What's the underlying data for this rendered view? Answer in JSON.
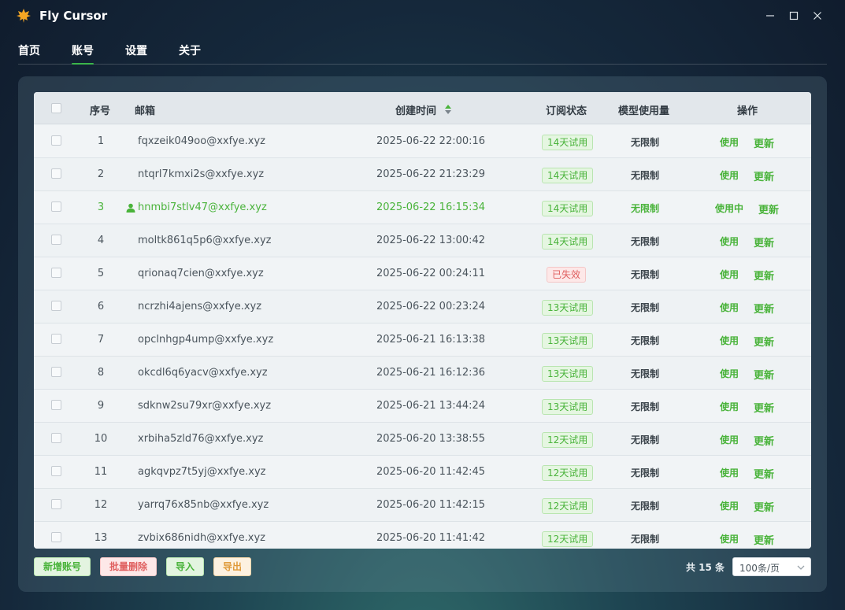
{
  "app": {
    "title": "Fly Cursor"
  },
  "nav": {
    "tabs": [
      "首页",
      "账号",
      "设置",
      "关于"
    ],
    "active": "账号"
  },
  "table": {
    "headers": {
      "index": "序号",
      "email": "邮箱",
      "created": "创建时间",
      "status": "订阅状态",
      "usage": "模型使用量",
      "actions": "操作"
    },
    "rows": [
      {
        "index": "1",
        "email": "fqxzeik049oo@xxfye.xyz",
        "created": "2025-06-22 22:00:16",
        "status": "14天试用",
        "status_type": "trial",
        "usage": "无限制",
        "use": "使用",
        "update": "更新",
        "active": false
      },
      {
        "index": "2",
        "email": "ntqrl7kmxi2s@xxfye.xyz",
        "created": "2025-06-22 21:23:29",
        "status": "14天试用",
        "status_type": "trial",
        "usage": "无限制",
        "use": "使用",
        "update": "更新",
        "active": false
      },
      {
        "index": "3",
        "email": "hnmbi7stlv47@xxfye.xyz",
        "created": "2025-06-22 16:15:34",
        "status": "14天试用",
        "status_type": "trial",
        "usage": "无限制",
        "use": "使用中",
        "update": "更新",
        "active": true
      },
      {
        "index": "4",
        "email": "moltk861q5p6@xxfye.xyz",
        "created": "2025-06-22 13:00:42",
        "status": "14天试用",
        "status_type": "trial",
        "usage": "无限制",
        "use": "使用",
        "update": "更新",
        "active": false
      },
      {
        "index": "5",
        "email": "qrionaq7cien@xxfye.xyz",
        "created": "2025-06-22 00:24:11",
        "status": "已失效",
        "status_type": "expired",
        "usage": "无限制",
        "use": "使用",
        "update": "更新",
        "active": false
      },
      {
        "index": "6",
        "email": "ncrzhi4ajens@xxfye.xyz",
        "created": "2025-06-22 00:23:24",
        "status": "13天试用",
        "status_type": "trial",
        "usage": "无限制",
        "use": "使用",
        "update": "更新",
        "active": false
      },
      {
        "index": "7",
        "email": "opclnhgp4ump@xxfye.xyz",
        "created": "2025-06-21 16:13:38",
        "status": "13天试用",
        "status_type": "trial",
        "usage": "无限制",
        "use": "使用",
        "update": "更新",
        "active": false
      },
      {
        "index": "8",
        "email": "okcdl6q6yacv@xxfye.xyz",
        "created": "2025-06-21 16:12:36",
        "status": "13天试用",
        "status_type": "trial",
        "usage": "无限制",
        "use": "使用",
        "update": "更新",
        "active": false
      },
      {
        "index": "9",
        "email": "sdknw2su79xr@xxfye.xyz",
        "created": "2025-06-21 13:44:24",
        "status": "13天试用",
        "status_type": "trial",
        "usage": "无限制",
        "use": "使用",
        "update": "更新",
        "active": false
      },
      {
        "index": "10",
        "email": "xrbiha5zld76@xxfye.xyz",
        "created": "2025-06-20 13:38:55",
        "status": "12天试用",
        "status_type": "trial",
        "usage": "无限制",
        "use": "使用",
        "update": "更新",
        "active": false
      },
      {
        "index": "11",
        "email": "agkqvpz7t5yj@xxfye.xyz",
        "created": "2025-06-20 11:42:45",
        "status": "12天试用",
        "status_type": "trial",
        "usage": "无限制",
        "use": "使用",
        "update": "更新",
        "active": false
      },
      {
        "index": "12",
        "email": "yarrq76x85nb@xxfye.xyz",
        "created": "2025-06-20 11:42:15",
        "status": "12天试用",
        "status_type": "trial",
        "usage": "无限制",
        "use": "使用",
        "update": "更新",
        "active": false
      },
      {
        "index": "13",
        "email": "zvbix686nidh@xxfye.xyz",
        "created": "2025-06-20 11:41:42",
        "status": "12天试用",
        "status_type": "trial",
        "usage": "无限制",
        "use": "使用",
        "update": "更新",
        "active": false
      }
    ]
  },
  "footer": {
    "add_label": "新增账号",
    "delete_label": "批量删除",
    "import_label": "导入",
    "export_label": "导出",
    "total": "共 15 条",
    "page_size": "100条/页"
  },
  "colors": {
    "accent": "#49b33a",
    "danger": "#e06060",
    "warning": "#e09a3a"
  },
  "icons": {
    "logo": "maple-leaf-icon",
    "minimize": "minimize-icon",
    "maximize": "maximize-icon",
    "close": "close-icon",
    "sort": "sort-icon",
    "active_user": "user-icon",
    "dropdown": "chevron-down-icon"
  }
}
